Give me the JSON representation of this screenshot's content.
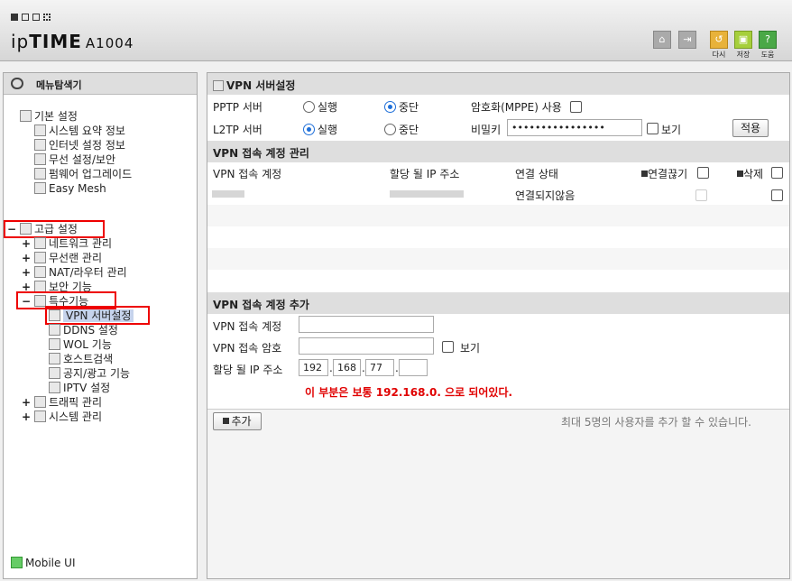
{
  "header": {
    "brand_a": "ip",
    "brand_b": "TIME",
    "model": "A1004",
    "btn_back": "다시",
    "btn_save": "저장",
    "btn_help": "도움"
  },
  "sidebar": {
    "title": "메뉴탐색기",
    "basic": {
      "label": "기본 설정",
      "items": [
        "시스템 요약 정보",
        "인터넷 설정 정보",
        "무선 설정/보안",
        "펌웨어 업그레이드",
        "Easy Mesh"
      ]
    },
    "advanced": {
      "label": "고급 설정",
      "items": [
        "네트워크 관리",
        "무선랜 관리",
        "NAT/라우터 관리",
        "보안 기능"
      ]
    },
    "special": {
      "label": "특수기능",
      "items": [
        "VPN 서버설정",
        "DDNS 설정",
        "WOL 기능",
        "호스트검색",
        "공지/광고 기능",
        "IPTV 설정"
      ]
    },
    "more": [
      "트래픽 관리",
      "시스템 관리"
    ],
    "mobile": "Mobile UI"
  },
  "main": {
    "title": "VPN 서버설정",
    "pptp_label": "PPTP 서버",
    "l2tp_label": "L2TP 서버",
    "run": "실행",
    "stop": "중단",
    "enc_label": "암호화(MPPE) 사용",
    "secret_label": "비밀키",
    "secret_value": "••••••••••••••••",
    "show": "보기",
    "apply": "적용",
    "acct_header": "VPN 접속 계정 관리",
    "cols": {
      "account": "VPN 접속 계정",
      "ip": "할당 될 IP 주소",
      "status": "연결 상태",
      "disconnect": "연결끊기",
      "delete": "삭제"
    },
    "row_status": "연결되지않음",
    "add_header": "VPN 접속 계정 추가",
    "add_account": "VPN 접속 계정",
    "add_password": "VPN 접속 암호",
    "add_ip": "할당 될 IP 주소",
    "ip1": "192",
    "ip2": "168",
    "ip3": "77",
    "ip4": "",
    "note": "이 부분은 보통 192.168.0. 으로 되어있다.",
    "add_btn": "추가",
    "max_note": "최대 5명의 사용자를 추가 할 수 있습니다."
  },
  "colors": {
    "highlight": "#e00000",
    "radio": "#1e6fd9"
  }
}
